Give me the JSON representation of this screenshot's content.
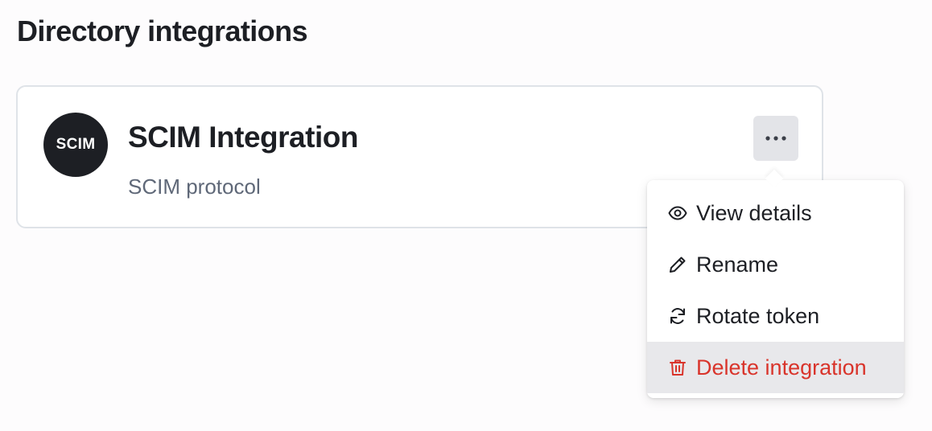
{
  "page": {
    "title": "Directory integrations"
  },
  "integration": {
    "logo_text": "SCIM",
    "name": "SCIM Integration",
    "protocol": "SCIM protocol"
  },
  "menu": {
    "items": [
      {
        "label": "View details",
        "icon": "eye-icon"
      },
      {
        "label": "Rename",
        "icon": "pencil-icon"
      },
      {
        "label": "Rotate token",
        "icon": "refresh-icon"
      },
      {
        "label": "Delete integration",
        "icon": "trash-icon",
        "color": "#d9342b",
        "highlighted": true
      }
    ]
  },
  "colors": {
    "text": "#1d1f24",
    "muted": "#5f6878",
    "danger": "#d9342b",
    "card_border": "#dfe3e8"
  }
}
